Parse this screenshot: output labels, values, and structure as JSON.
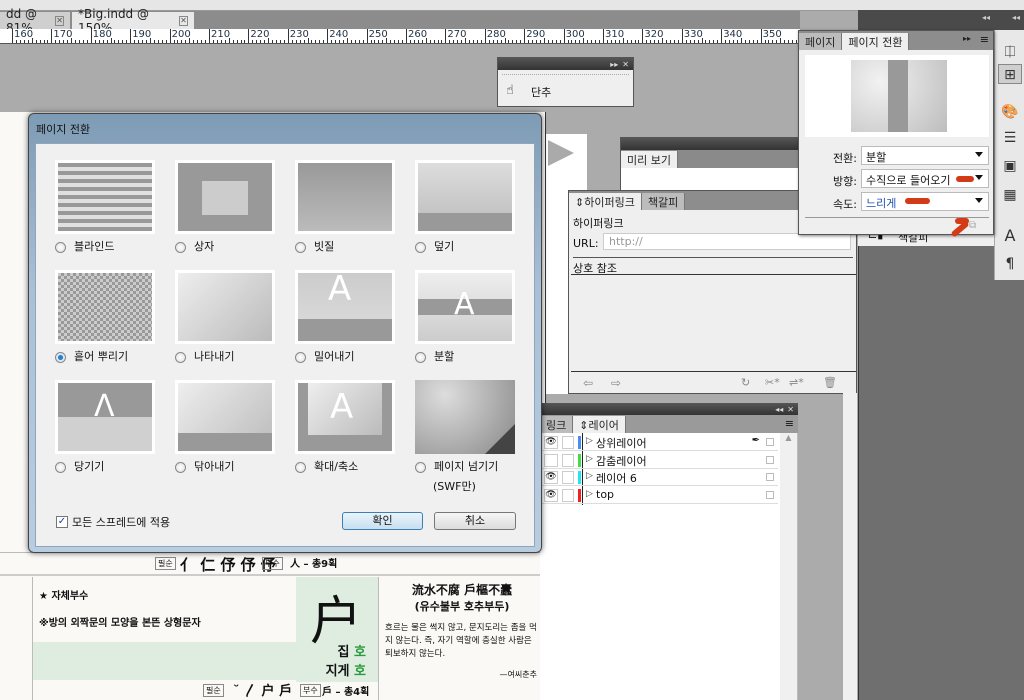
{
  "doc_tabs": [
    {
      "label": "dd @ 81%"
    },
    {
      "label": "*Big.indd @ 150%"
    }
  ],
  "ruler": [
    "160",
    "170",
    "180",
    "190",
    "200",
    "210",
    "220",
    "230",
    "240",
    "250",
    "260",
    "270",
    "280",
    "290",
    "300",
    "310",
    "320",
    "330",
    "340",
    "350"
  ],
  "button_panel": {
    "item": "단추"
  },
  "dialog": {
    "title": "페이지 전환",
    "options": [
      {
        "label": "블라인드",
        "selected": false
      },
      {
        "label": "상자",
        "selected": false
      },
      {
        "label": "빗질",
        "selected": false
      },
      {
        "label": "덮기",
        "selected": false
      },
      {
        "label": "흩어 뿌리기",
        "selected": true
      },
      {
        "label": "나타내기",
        "selected": false
      },
      {
        "label": "밀어내기",
        "selected": false
      },
      {
        "label": "분할",
        "selected": false
      },
      {
        "label": "당기기",
        "selected": false
      },
      {
        "label": "닦아내기",
        "selected": false
      },
      {
        "label": "확대/축소",
        "selected": false
      },
      {
        "label": "페이지 넘기기",
        "sub": "(SWF만)",
        "selected": false
      }
    ],
    "apply_all": "모든 스프레드에 적용",
    "apply_all_checked": true,
    "ok": "확인",
    "cancel": "취소"
  },
  "preview_panel": {
    "tab": "미리 보기"
  },
  "hyperlink_panel": {
    "tabs": [
      "하이퍼링크",
      "책갈피"
    ],
    "section": "하이퍼링크",
    "url_label": "URL:",
    "url_placeholder": "http://",
    "cross_ref": "상호 참조"
  },
  "layers_panel": {
    "tabs": [
      "링크",
      "레이어"
    ],
    "layers": [
      {
        "name": "상위레이어",
        "visible": true,
        "color": "#4a8cf0"
      },
      {
        "name": "감춤레이어",
        "visible": false,
        "color": "#44dd44"
      },
      {
        "name": "레이어 6",
        "visible": true,
        "color": "#22e5f0"
      },
      {
        "name": "top",
        "visible": true,
        "color": "#ee2222"
      }
    ]
  },
  "transition_panel": {
    "tabs": [
      "페이지",
      "페이지 전환"
    ],
    "transition_label": "전환:",
    "transition_value": "분할",
    "direction_label": "방향:",
    "direction_value": "수직으로 들어오기",
    "speed_label": "속도:",
    "speed_value": "느리게"
  },
  "bookmark_item": "책갈피",
  "document": {
    "title_line": "★ 자체부수",
    "desc": "※방의 외짝문의 모양을 본뜬 상형문자",
    "hanja": "户",
    "meaning1": "집",
    "reading1": "호",
    "meaning2": "지게",
    "reading2": "호",
    "proverb": "流水不腐 戶樞不蠹",
    "proverb_reading": "(유수불부 호추부두)",
    "explanation": "흐르는 물은 썩지 않고, 문지도리는 좀을 먹지 않는다. 즉, 자기 역할에 충실한 사람은 퇴보하지 않는다.",
    "source": "—여씨춘추",
    "stroke_top": "人 – 총9획",
    "stroke_bottom": "戶 – 총4획",
    "label_stroke": "필순",
    "label_radical": "부수"
  }
}
